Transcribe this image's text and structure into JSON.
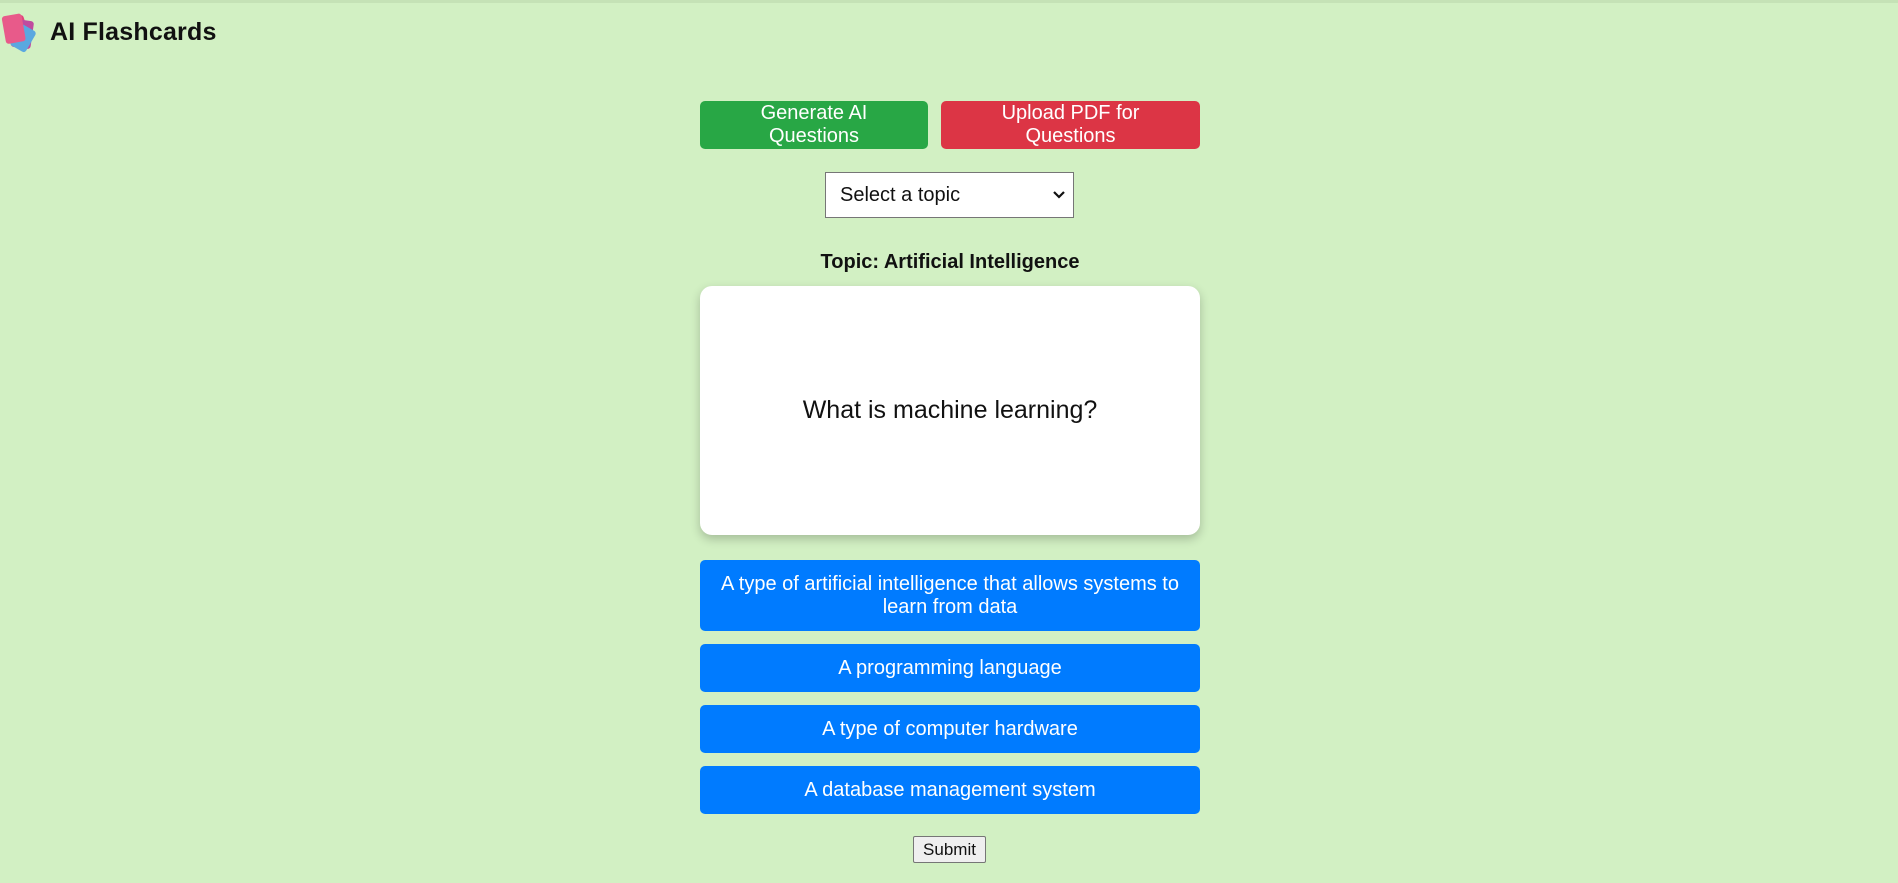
{
  "header": {
    "title": "AI Flashcards",
    "logo_icon": "flashcards-logo-icon"
  },
  "actions": {
    "generate_label": "Generate AI Questions",
    "upload_label": "Upload PDF for Questions"
  },
  "topic_select": {
    "selected": "Select a topic"
  },
  "topic": {
    "label": "Topic: Artificial Intelligence"
  },
  "card": {
    "question": "What is machine learning?"
  },
  "answers": [
    {
      "text": "A type of artificial intelligence that allows systems to learn from data"
    },
    {
      "text": "A programming language"
    },
    {
      "text": "A type of computer hardware"
    },
    {
      "text": "A database management system"
    }
  ],
  "submit_label": "Submit",
  "colors": {
    "background": "#d2f0c3",
    "generate": "#28a745",
    "upload": "#dc3545",
    "answer": "#007bff"
  }
}
